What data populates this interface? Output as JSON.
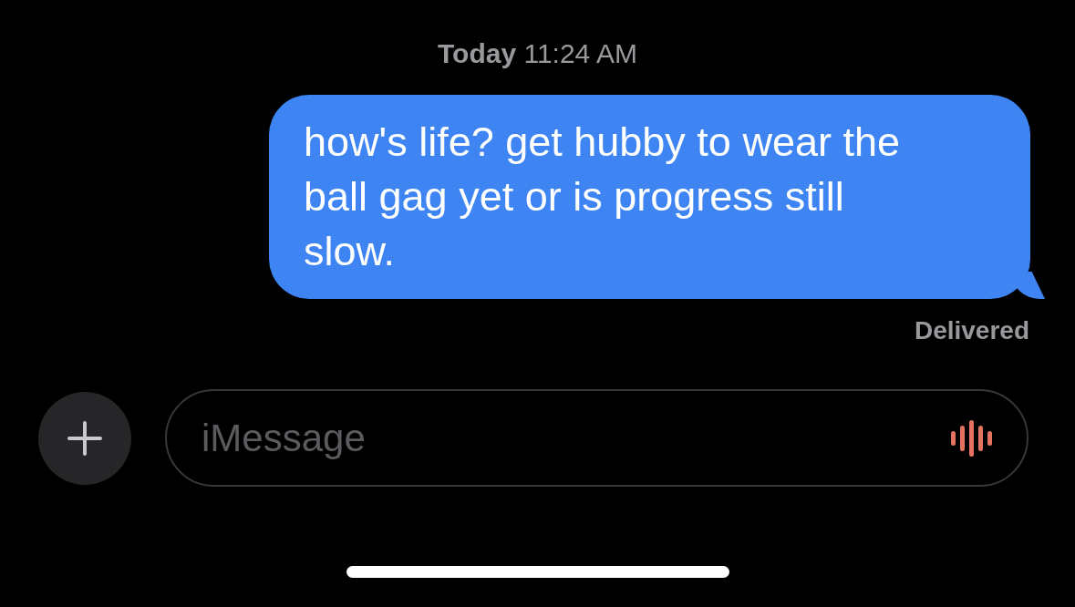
{
  "timestamp": {
    "day": "Today",
    "time": "11:24 AM"
  },
  "messages": [
    {
      "kind": "sent",
      "text": "how's life? get hubby to wear the ball gag yet or is progress still slow.",
      "status": "Delivered"
    }
  ],
  "compose": {
    "placeholder": "iMessage"
  }
}
